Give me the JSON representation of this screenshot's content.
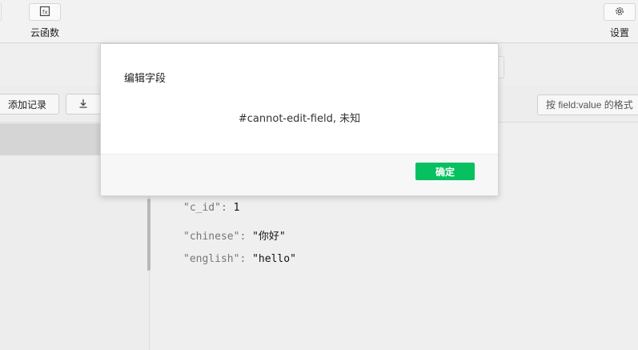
{
  "toolbar": {
    "cloud_functions_label": "云函数",
    "settings_label": "设置"
  },
  "actions": {
    "add_record_label": "添加记录",
    "filter_placeholder": "按 field:value 的格式"
  },
  "record": {
    "fields": [
      {
        "key": "\"c_id\"",
        "value": "1"
      },
      {
        "key": "\"chinese\"",
        "value": "\"你好\""
      },
      {
        "key": "\"english\"",
        "value": "\"hello\""
      }
    ]
  },
  "dialog": {
    "title": "编辑字段",
    "message": "#cannot-edit-field, 未知",
    "confirm_label": "确定"
  },
  "colors": {
    "accent": "#07c160"
  },
  "icons": {
    "cloud_functions": "function-box-icon",
    "settings": "gear-icon",
    "export": "download-icon"
  }
}
